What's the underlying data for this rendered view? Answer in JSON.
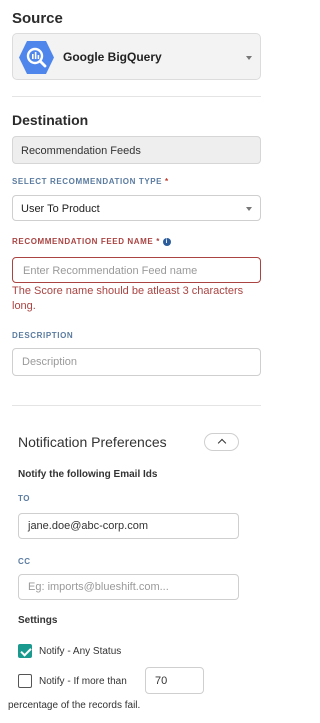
{
  "source": {
    "heading": "Source",
    "selected": "Google BigQuery",
    "icon": "bigquery-icon",
    "icon_color": "#4f86ec"
  },
  "destination": {
    "heading": "Destination",
    "value": "Recommendation Feeds"
  },
  "recommendation_type": {
    "label": "SELECT RECOMMENDATION TYPE",
    "required_mark": "*",
    "selected": "User To Product"
  },
  "feed_name": {
    "label": "RECOMMENDATION FEED NAME",
    "required_mark": "*",
    "placeholder": "Enter Recommendation Feed name",
    "error": "The Score name should be atleast 3 characters long."
  },
  "description": {
    "label": "DESCRIPTION",
    "placeholder": "Description"
  },
  "notifications": {
    "title": "Notification Preferences",
    "notify_heading": "Notify the following Email Ids",
    "to_label": "TO",
    "to_value": "jane.doe@abc-corp.com",
    "cc_label": "CC",
    "cc_placeholder": "Eg: imports@blueshift.com...",
    "settings_heading": "Settings",
    "notify_any_label": "Notify - Any Status",
    "notify_any_checked": true,
    "notify_if_label": "Notify - If more than",
    "notify_if_checked": false,
    "threshold_value": "70",
    "threshold_suffix": "percentage of the records fail."
  },
  "colors": {
    "error": "#a94442",
    "accent": "#1a9a8f",
    "label_blue": "#5a7ba0"
  }
}
